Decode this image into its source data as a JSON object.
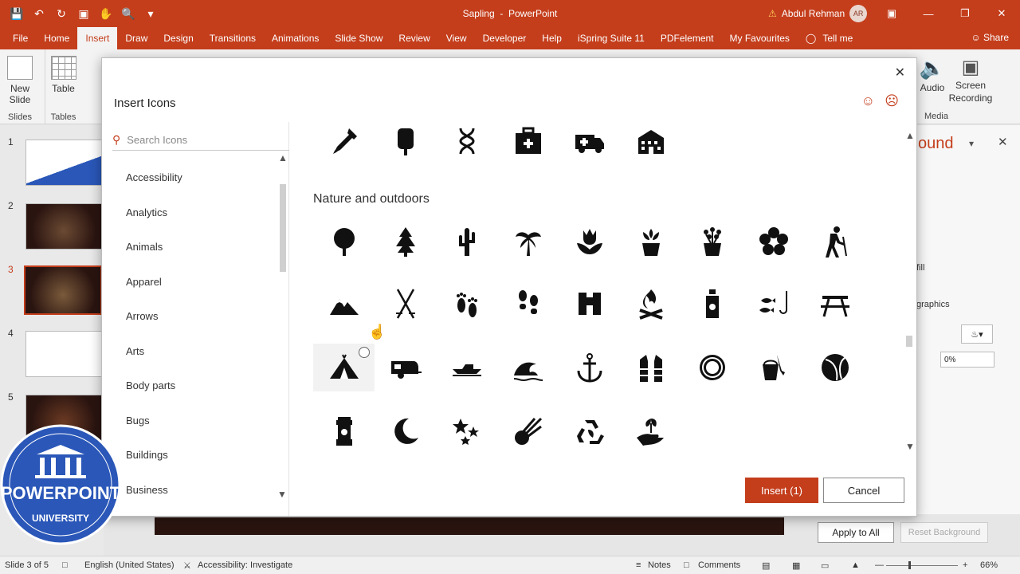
{
  "app": {
    "document": "Sapling",
    "app_name": "PowerPoint",
    "title_sep": "-",
    "user": "Abdul Rehman",
    "user_initials": "AR"
  },
  "tabs": [
    "File",
    "Home",
    "Insert",
    "Draw",
    "Design",
    "Transitions",
    "Animations",
    "Slide Show",
    "Review",
    "View",
    "Developer",
    "Help",
    "iSpring Suite 11",
    "PDFelement",
    "My Favourites",
    "Tell me"
  ],
  "active_tab": "Insert",
  "share_label": "Share",
  "ribbon": {
    "new_slide": "New Slide",
    "table": "Table",
    "slides_group": "Slides",
    "tables_group": "Tables",
    "audio": "Audio",
    "screen_recording": "Screen Recording",
    "media_group": "Media"
  },
  "thumbnails": [
    "1",
    "2",
    "3",
    "4",
    "5"
  ],
  "right_pane": {
    "heading_fragment": "ound",
    "fill_fragment": "fill",
    "graphics_fragment": "graphics",
    "transparency": "0%"
  },
  "bottom": {
    "apply_all": "Apply to All",
    "reset_bg": "Reset Background"
  },
  "status": {
    "slide_info": "Slide 3 of 5",
    "language": "English (United States)",
    "accessibility": "Accessibility: Investigate",
    "notes": "Notes",
    "comments": "Comments",
    "zoom": "66%"
  },
  "dialog": {
    "title": "Insert Icons",
    "search_placeholder": "Search Icons",
    "categories": [
      "Accessibility",
      "Analytics",
      "Animals",
      "Apparel",
      "Arrows",
      "Arts",
      "Body parts",
      "Bugs",
      "Buildings",
      "Business"
    ],
    "section_title": "Nature and outdoors",
    "insert_label": "Insert (1)",
    "cancel_label": "Cancel",
    "medical_row": [
      "dropper-icon",
      "iv-bag-icon",
      "dna-icon",
      "first-aid-kit-icon",
      "ambulance-icon",
      "hospital-icon"
    ],
    "nature_rows": [
      [
        "tree-icon",
        "pine-tree-icon",
        "cactus-icon",
        "palm-tree-icon",
        "tulip-icon",
        "potted-plant-icon",
        "flower-pot-icon",
        "flower-icon",
        "hiker-icon"
      ],
      [
        "mountains-icon",
        "ski-poles-icon",
        "footprints-icon",
        "shoe-prints-icon",
        "binoculars-icon",
        "campfire-icon",
        "water-bottle-icon",
        "fishing-icon",
        "picnic-table-icon"
      ],
      [
        "tent-icon",
        "camper-trailer-icon",
        "boat-icon",
        "wave-icon",
        "anchor-icon",
        "life-vest-icon",
        "lifebuoy-icon",
        "beach-bucket-icon",
        "beach-ball-icon"
      ],
      [
        "lantern-icon",
        "moon-icon",
        "stars-icon",
        "comet-icon",
        "recycle-icon",
        "hand-plant-icon"
      ]
    ]
  },
  "logo": {
    "line1": "POWERPOINT",
    "line2": "UNIVERSITY"
  },
  "colors": {
    "accent": "#c43e1c"
  }
}
